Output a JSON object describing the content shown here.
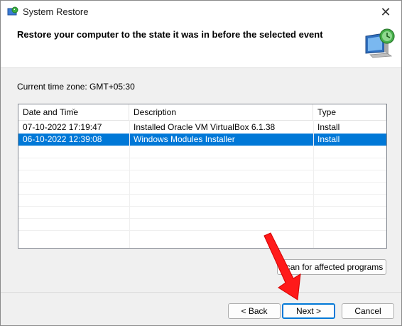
{
  "window": {
    "title": "System Restore",
    "close_glyph": "✕"
  },
  "header": {
    "title": "Restore your computer to the state it was in before the selected event"
  },
  "timezone": {
    "label": "Current time zone: GMT+05:30"
  },
  "list": {
    "columns": [
      "Date and Time",
      "Description",
      "Type"
    ],
    "rows": [
      {
        "date": "07-10-2022 17:19:47",
        "description": "Installed Oracle VM VirtualBox 6.1.38",
        "type": "Install",
        "selected": false
      },
      {
        "date": "06-10-2022 12:39:08",
        "description": "Windows Modules Installer",
        "type": "Install",
        "selected": true
      }
    ],
    "sort_glyph": "⌄"
  },
  "buttons": {
    "scan": "Scan for affected programs",
    "back": "< Back",
    "next": "Next >",
    "cancel": "Cancel"
  },
  "colors": {
    "selection": "#0078d7",
    "annotation_arrow": "#ff1a1a"
  }
}
